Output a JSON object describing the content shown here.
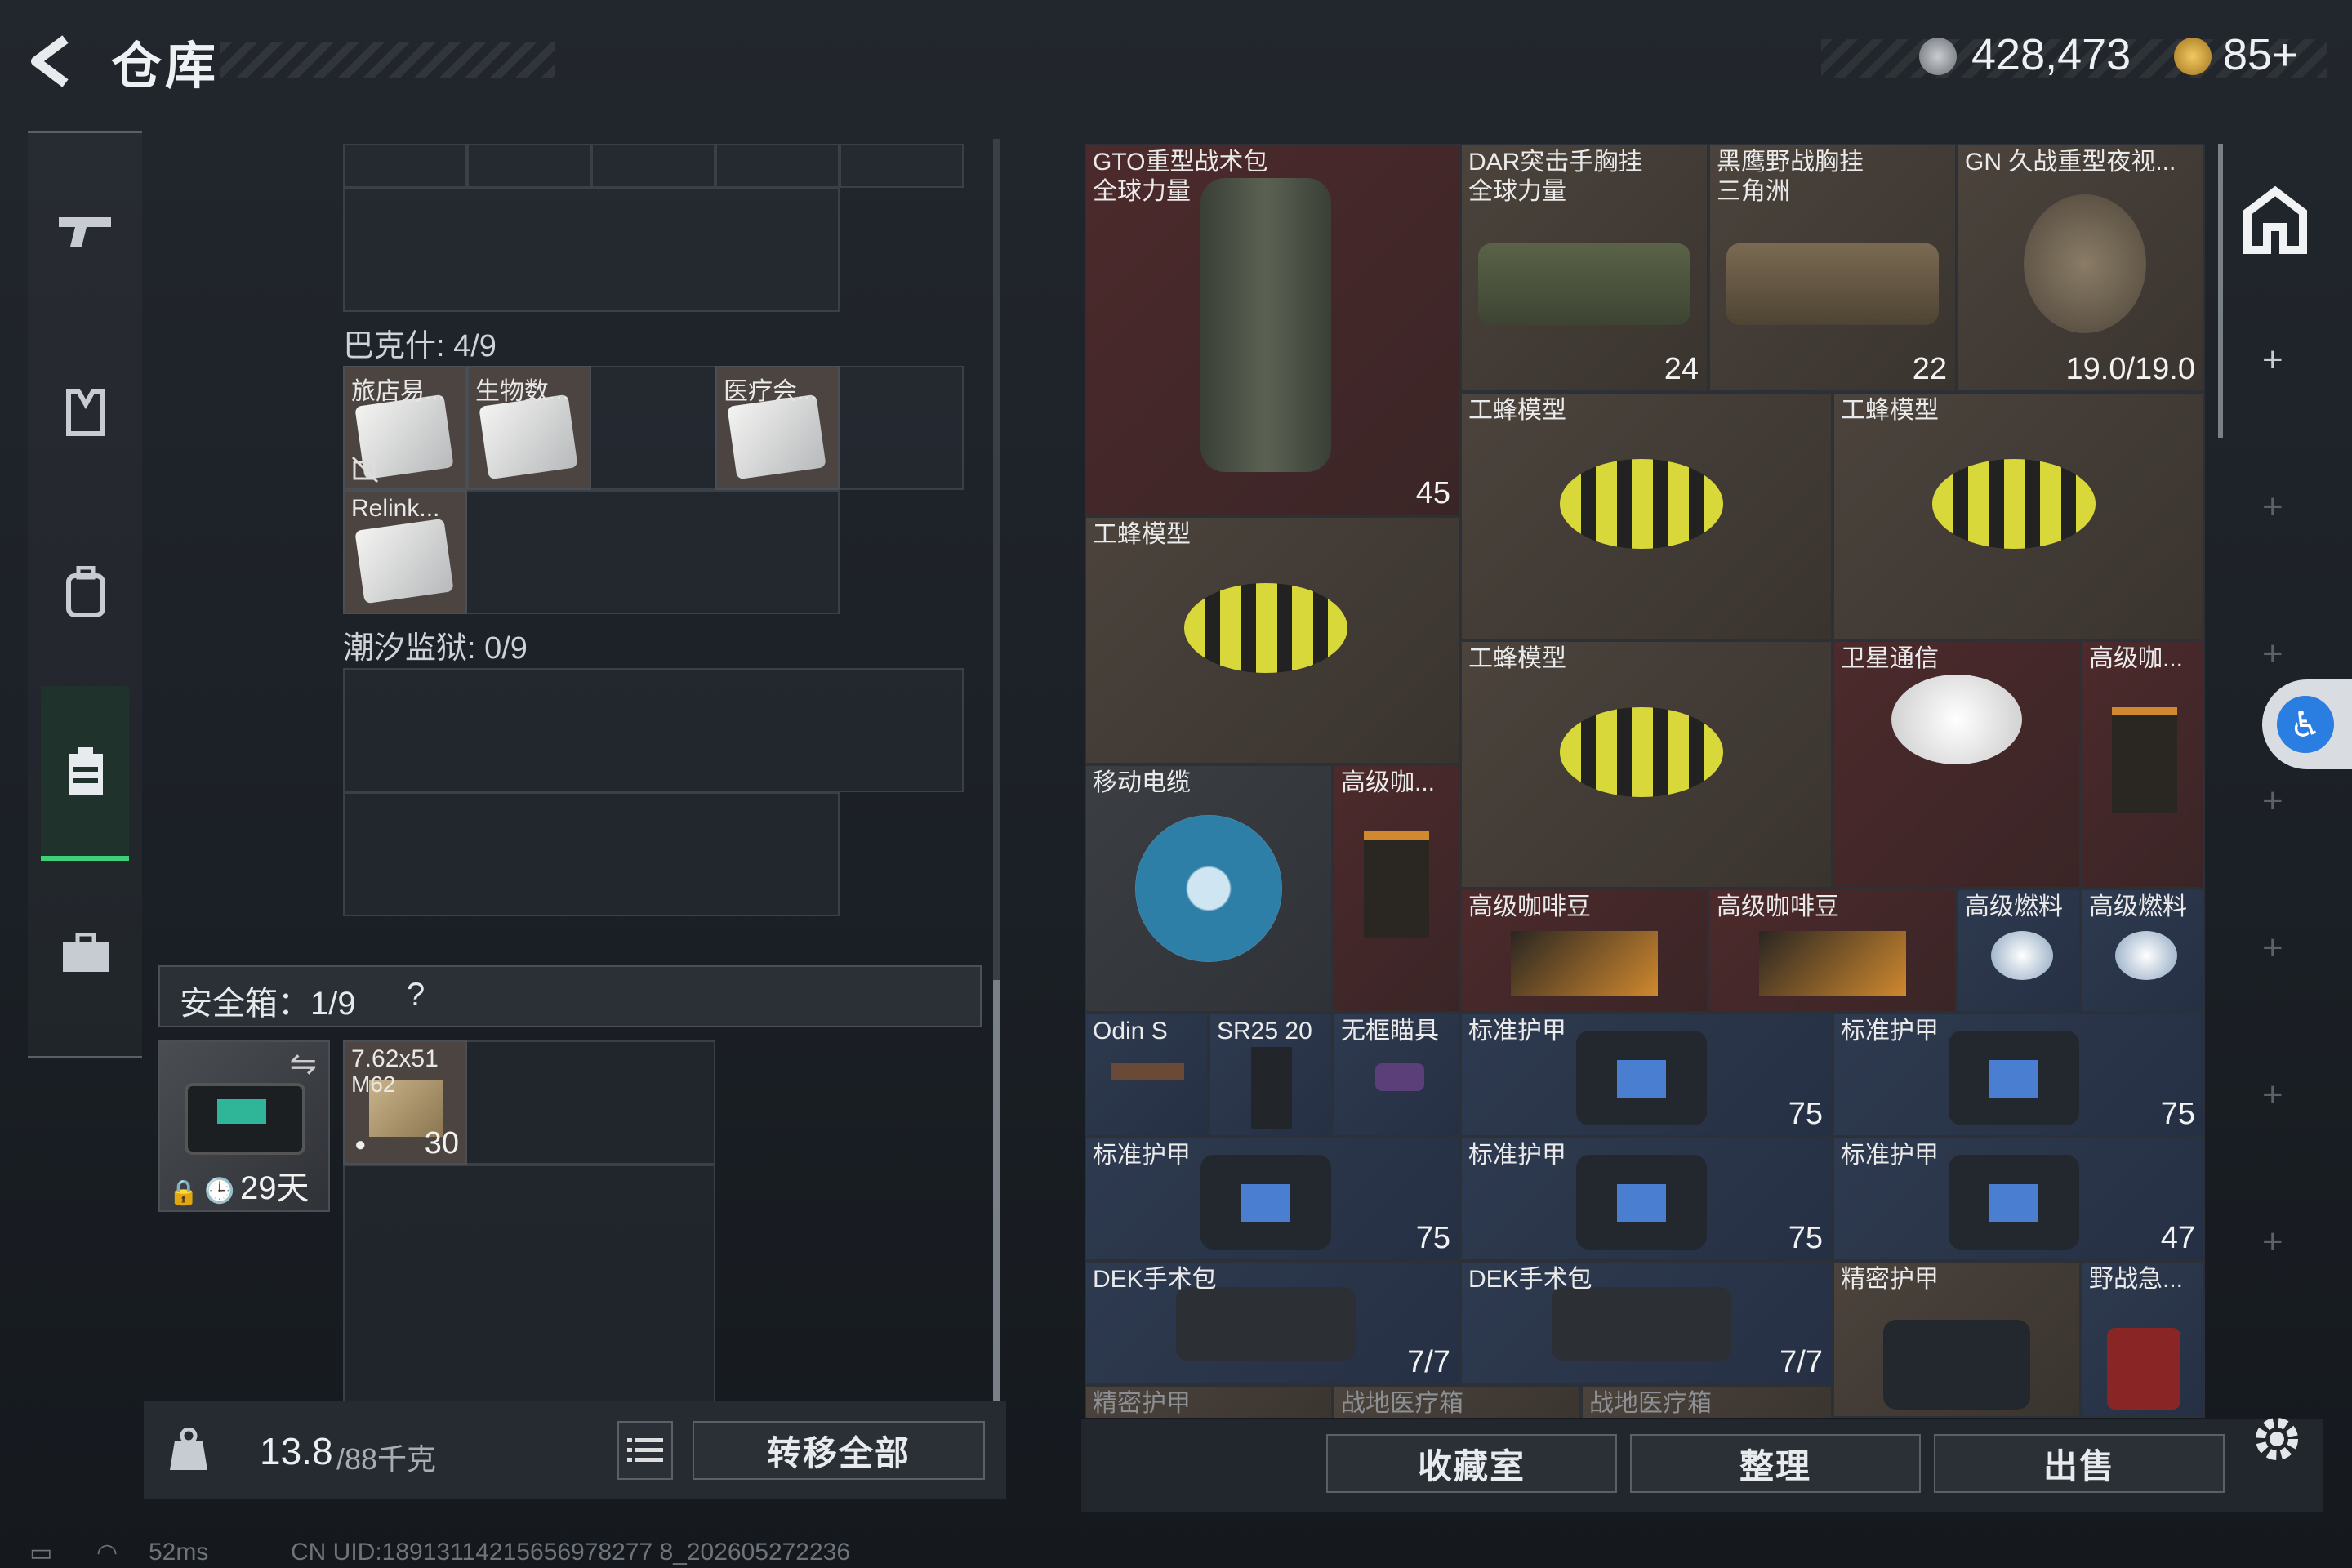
{
  "header": {
    "title": "仓库",
    "currency_1": "428,473",
    "currency_2": "85+"
  },
  "storage": {
    "sections": [
      {
        "label": "巴克什: 4/9",
        "items": [
          "旅店易...",
          "生物数...",
          "医疗会...",
          "Relink..."
        ]
      },
      {
        "label": "潮汐监狱: 0/9",
        "items": []
      }
    ],
    "safe_box": {
      "label": "安全箱：1/9",
      "help": "?",
      "timer": "29天",
      "ammo": {
        "name": "7.62x51",
        "sub": "M62",
        "count": "30"
      }
    },
    "weight": {
      "current": "13.8",
      "max": "/88千克"
    },
    "transfer_all": "转移全部"
  },
  "panel": {
    "items": [
      {
        "name": "GTO重型战术包",
        "sub": "全球力量",
        "badge": "45"
      },
      {
        "name": "DAR突击手胸挂",
        "sub": "全球力量",
        "badge": "24"
      },
      {
        "name": "黑鹰野战胸挂",
        "sub": "三角洲",
        "badge": "22"
      },
      {
        "name": "GN 久战重型夜视...",
        "badge": "19.0/19.0"
      },
      {
        "name": "工蜂模型"
      },
      {
        "name": "工蜂模型"
      },
      {
        "name": "工蜂模型"
      },
      {
        "name": "工蜂模型"
      },
      {
        "name": "卫星通信"
      },
      {
        "name": "高级咖..."
      },
      {
        "name": "移动电缆"
      },
      {
        "name": "高级咖..."
      },
      {
        "name": "高级咖啡豆"
      },
      {
        "name": "高级咖啡豆"
      },
      {
        "name": "高级燃料"
      },
      {
        "name": "高级燃料"
      },
      {
        "name": "Odin S"
      },
      {
        "name": "SR25 20"
      },
      {
        "name": "无框瞄具"
      },
      {
        "name": "标准护甲",
        "badge": "75"
      },
      {
        "name": "标准护甲",
        "badge": "75"
      },
      {
        "name": "标准护甲",
        "badge": "75"
      },
      {
        "name": "标准护甲",
        "badge": "75"
      },
      {
        "name": "标准护甲",
        "badge": "47"
      },
      {
        "name": "DEK手术包",
        "badge": "7/7"
      },
      {
        "name": "DEK手术包",
        "badge": "7/7"
      },
      {
        "name": "精密护甲"
      },
      {
        "name": "野战急..."
      },
      {
        "name": "精密护甲"
      },
      {
        "name": "战地医疗箱"
      },
      {
        "name": "战地医疗箱"
      }
    ],
    "buttons": {
      "collection": "收藏室",
      "sort": "整理",
      "sell": "出售"
    }
  },
  "status": {
    "ping": "52ms",
    "uid": "CN UID:18913114215656978277 8_202605272236"
  },
  "colors": {
    "accent_green": "#3fd17a",
    "bg": "#1e2328"
  }
}
